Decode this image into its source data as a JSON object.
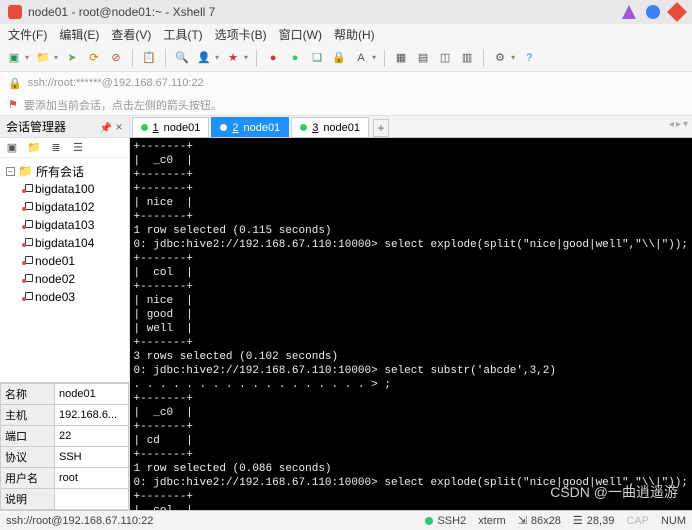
{
  "window": {
    "title": "node01 - root@node01:~ - Xshell 7"
  },
  "menu": {
    "file": "文件(F)",
    "edit": "编辑(E)",
    "view": "查看(V)",
    "tools": "工具(T)",
    "tab": "选项卡(B)",
    "window": "窗口(W)",
    "help": "帮助(H)"
  },
  "address": {
    "value": "ssh://root:******@192.168.67.110:22"
  },
  "hint": {
    "text": "要添加当前会话，点击左侧的箭头按钮。"
  },
  "session_panel": {
    "title": "会话管理器",
    "root": "所有会话",
    "items": [
      "bigdata100",
      "bigdata102",
      "bigdata103",
      "bigdata104",
      "node01",
      "node02",
      "node03"
    ]
  },
  "props": {
    "name_k": "名称",
    "name_v": "node01",
    "host_k": "主机",
    "host_v": "192.168.6...",
    "port_k": "端口",
    "port_v": "22",
    "proto_k": "协议",
    "proto_v": "SSH",
    "user_k": "用户名",
    "user_v": "root",
    "desc_k": "说明",
    "desc_v": ""
  },
  "tabs": {
    "items": [
      {
        "num": "1",
        "label": "node01",
        "active": false
      },
      {
        "num": "2",
        "label": "node01",
        "active": true
      },
      {
        "num": "3",
        "label": "node01",
        "active": false
      }
    ]
  },
  "terminal": {
    "lines": "+-------+\n|  _c0  |\n+-------+\n+-------+\n| nice  |\n+-------+\n1 row selected (0.115 seconds)\n0: jdbc:hive2://192.168.67.110:10000> select explode(split(\"nice|good|well\",\"\\\\|\"));\n+-------+\n|  col  |\n+-------+\n| nice  |\n| good  |\n| well  |\n+-------+\n3 rows selected (0.102 seconds)\n0: jdbc:hive2://192.168.67.110:10000> select substr('abcde',3,2)\n. . . . . . . . . . . . . . . . . . > ;\n+-------+\n|  _c0  |\n+-------+\n| cd    |\n+-------+\n1 row selected (0.086 seconds)\n0: jdbc:hive2://192.168.67.110:10000> select explode(split(\"nice|good|well\",\"\\\\|\"));\n+-------+\n|  col  |\n+-------+\n| nice  |"
  },
  "status": {
    "left": "ssh://root@192.168.67.110:22",
    "ssh": "SSH2",
    "term": "xterm",
    "size": "86x28",
    "pos": "28,39",
    "cap": "CAP",
    "num": "NUM"
  },
  "watermark": "CSDN @一曲逍遥游"
}
